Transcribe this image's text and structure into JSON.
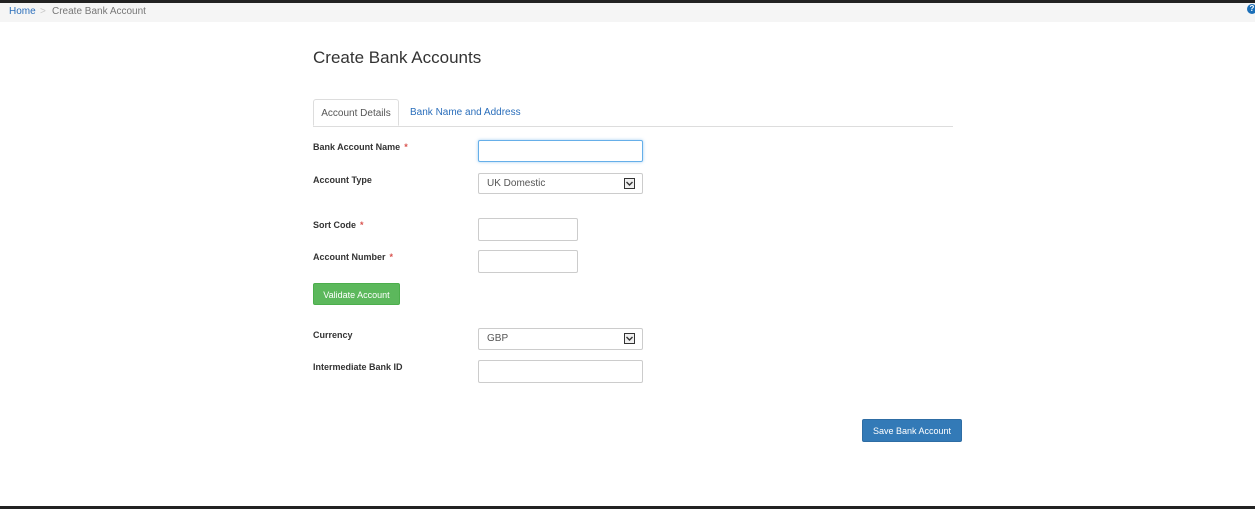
{
  "breadcrumb": {
    "home": "Home",
    "separator": ">",
    "current": "Create Bank Account"
  },
  "help_icon": "?",
  "page": {
    "title": "Create Bank Accounts"
  },
  "tabs": [
    {
      "label": "Account Details",
      "active": true
    },
    {
      "label": "Bank Name and Address",
      "active": false
    }
  ],
  "form": {
    "required_marker": "*",
    "bank_account_name": {
      "label": "Bank Account Name",
      "value": "",
      "required": true
    },
    "account_type": {
      "label": "Account Type",
      "value": "UK Domestic"
    },
    "sort_code": {
      "label": "Sort Code",
      "value": "",
      "required": true
    },
    "account_number": {
      "label": "Account Number",
      "value": "",
      "required": true
    },
    "validate_button": "Validate Account",
    "currency": {
      "label": "Currency",
      "value": "GBP"
    },
    "intermediate_bank_id": {
      "label": "Intermediate Bank ID",
      "value": ""
    },
    "save_button": "Save Bank Account"
  },
  "colors": {
    "link": "#2a6ebb",
    "required": "#d9534f",
    "success_button": "#5cb85c",
    "primary_button": "#337ab7"
  }
}
